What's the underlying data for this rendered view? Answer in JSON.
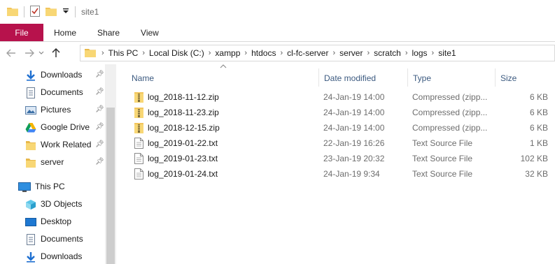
{
  "window": {
    "title": "site1",
    "accent": "#b7124c"
  },
  "quick_access_toolbar": [
    {
      "icon": "folder-icon"
    },
    {
      "icon": "properties-check-icon"
    },
    {
      "icon": "new-folder-icon"
    },
    {
      "icon": "customize-dropdown-icon"
    }
  ],
  "ribbon": {
    "tabs": [
      "File",
      "Home",
      "Share",
      "View"
    ]
  },
  "address_bar": {
    "crumbs": [
      "This PC",
      "Local Disk (C:)",
      "xampp",
      "htdocs",
      "cl-fc-server",
      "server",
      "scratch",
      "logs",
      "site1"
    ]
  },
  "navigation_pane": {
    "quick_access": [
      {
        "label": "Downloads",
        "icon": "download-arrow-icon",
        "pinned": true
      },
      {
        "label": "Documents",
        "icon": "documents-icon",
        "pinned": true
      },
      {
        "label": "Pictures",
        "icon": "pictures-icon",
        "pinned": true
      },
      {
        "label": "Google Drive",
        "icon": "google-drive-icon",
        "pinned": true
      },
      {
        "label": "Work Related",
        "icon": "folder-icon",
        "pinned": true
      },
      {
        "label": "server",
        "icon": "folder-icon",
        "pinned": true
      }
    ],
    "this_pc": {
      "label": "This PC",
      "children": [
        {
          "label": "3D Objects",
          "icon": "3d-objects-icon"
        },
        {
          "label": "Desktop",
          "icon": "desktop-icon"
        },
        {
          "label": "Documents",
          "icon": "documents-icon"
        },
        {
          "label": "Downloads",
          "icon": "download-arrow-icon"
        }
      ]
    }
  },
  "file_list": {
    "columns": [
      "Name",
      "Date modified",
      "Type",
      "Size"
    ],
    "rows": [
      {
        "name": "log_2018-11-12.zip",
        "date": "24-Jan-19 14:00",
        "type": "Compressed (zipp...",
        "size": "6 KB",
        "icon": "zip-folder-icon"
      },
      {
        "name": "log_2018-11-23.zip",
        "date": "24-Jan-19 14:00",
        "type": "Compressed (zipp...",
        "size": "6 KB",
        "icon": "zip-folder-icon"
      },
      {
        "name": "log_2018-12-15.zip",
        "date": "24-Jan-19 14:00",
        "type": "Compressed (zipp...",
        "size": "6 KB",
        "icon": "zip-folder-icon"
      },
      {
        "name": "log_2019-01-22.txt",
        "date": "22-Jan-19 16:26",
        "type": "Text Source File",
        "size": "1 KB",
        "icon": "text-file-icon"
      },
      {
        "name": "log_2019-01-23.txt",
        "date": "23-Jan-19 20:32",
        "type": "Text Source File",
        "size": "102 KB",
        "icon": "text-file-icon"
      },
      {
        "name": "log_2019-01-24.txt",
        "date": "24-Jan-19 9:34",
        "type": "Text Source File",
        "size": "32 KB",
        "icon": "text-file-icon"
      }
    ]
  }
}
